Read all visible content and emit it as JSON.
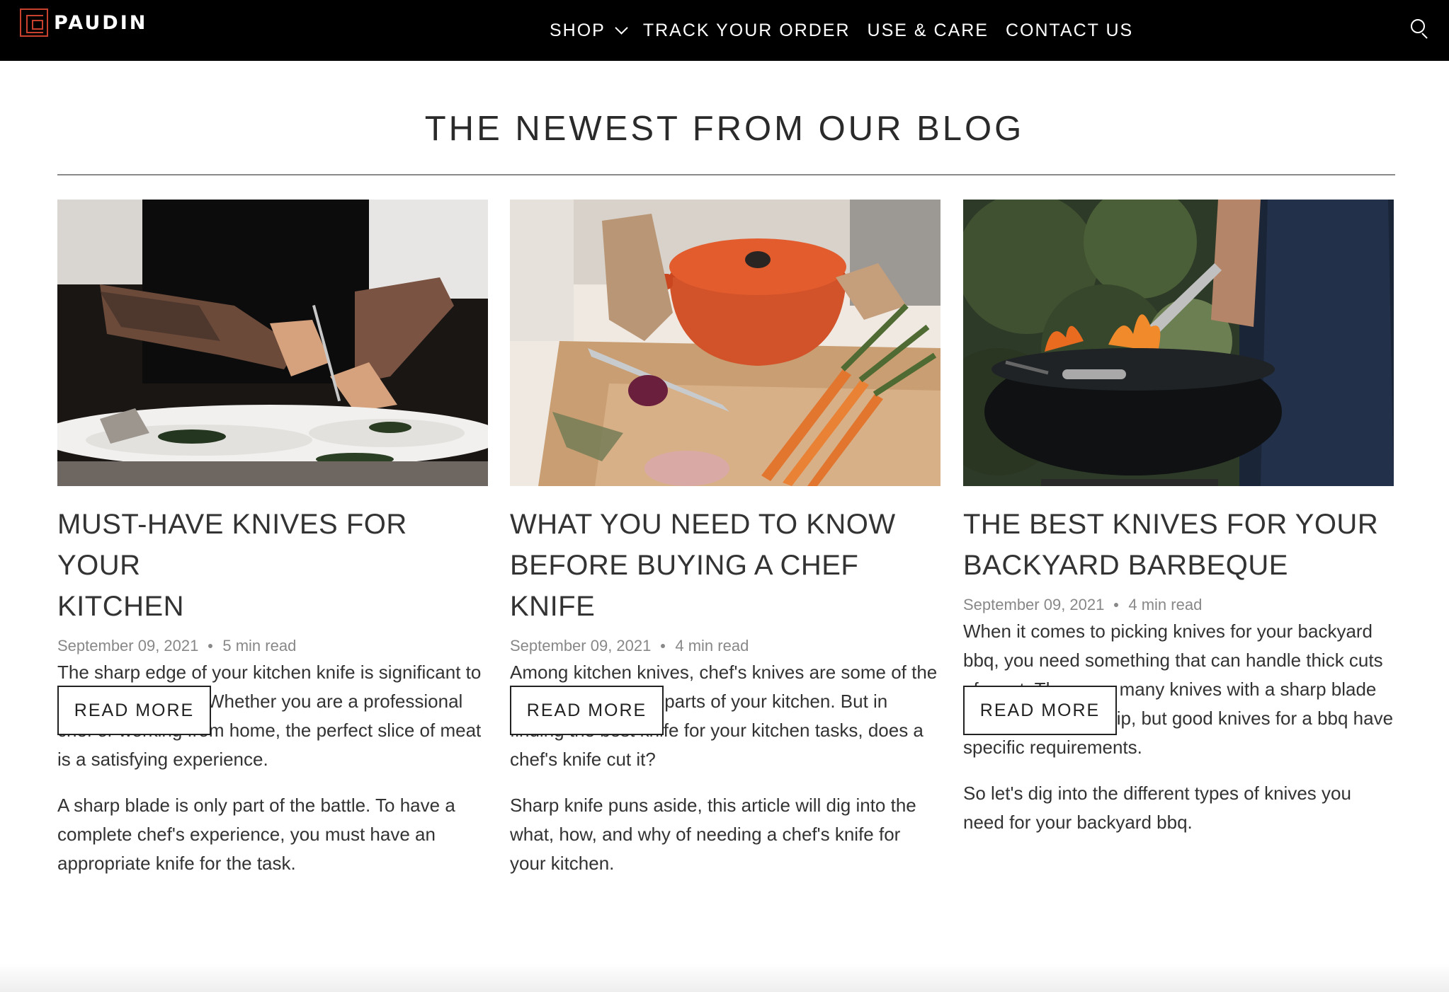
{
  "header": {
    "brand": "PAUDIN",
    "nav": [
      {
        "label": "SHOP",
        "has_dropdown": true
      },
      {
        "label": "TRACK YOUR ORDER"
      },
      {
        "label": "USE & CARE"
      },
      {
        "label": "CONTACT US"
      }
    ],
    "icons": {
      "logo": "paudin-logo-icon",
      "dropdown": "chevron-down-icon",
      "search": "search-icon"
    },
    "colors": {
      "background": "#000000",
      "text": "#ffffff",
      "logo_accent": "#c8412e"
    }
  },
  "section": {
    "title": "THE NEWEST FROM OUR BLOG"
  },
  "posts": [
    {
      "title": "MUST-HAVE KNIVES FOR YOUR KITCHEN",
      "title_lines": [
        "MUST-HAVE KNIVES FOR YOUR",
        "KITCHEN"
      ],
      "date": "September 09, 2021",
      "read_time": "5 min read",
      "paragraphs": [
        "The sharp edge of your kitchen knife is significant to create clean cuts. Whether you are a professional chef or working from home, the perfect slice of meat is a satisfying experience.",
        "A sharp blade is only part of the battle. To have a complete chef's experience, you must have an appropriate knife for the task."
      ],
      "button": "READ MORE"
    },
    {
      "title": "WHAT YOU NEED TO KNOW BEFORE BUYING A CHEF KNIFE",
      "title_lines": [
        "WHAT YOU NEED TO KNOW",
        "BEFORE BUYING A CHEF KNIFE"
      ],
      "date": "September 09, 2021",
      "read_time": "4 min read",
      "paragraphs": [
        "Among kitchen knives, chef's knives are some of the most recognizable parts of your kitchen. But in finding the best knife for your kitchen tasks, does a chef's knife cut it?",
        "Sharp knife puns aside, this article will dig into the what, how, and why of needing a chef's knife for your kitchen."
      ],
      "button": "READ MORE"
    },
    {
      "title": "THE BEST KNIVES FOR YOUR BACKYARD BARBEQUE",
      "title_lines": [
        "THE BEST KNIVES FOR YOUR",
        "BACKYARD BARBEQUE"
      ],
      "date": "September 09, 2021",
      "read_time": "4 min read",
      "paragraphs": [
        "When it comes to picking knives for your backyard bbq, you need something that can handle thick cuts of meat. There are many knives with a sharp blade and comfortable grip, but good knives for a bbq have specific requirements.",
        "So let's dig into the different types of knives you need for your backyard bbq."
      ],
      "button": "READ MORE"
    }
  ]
}
